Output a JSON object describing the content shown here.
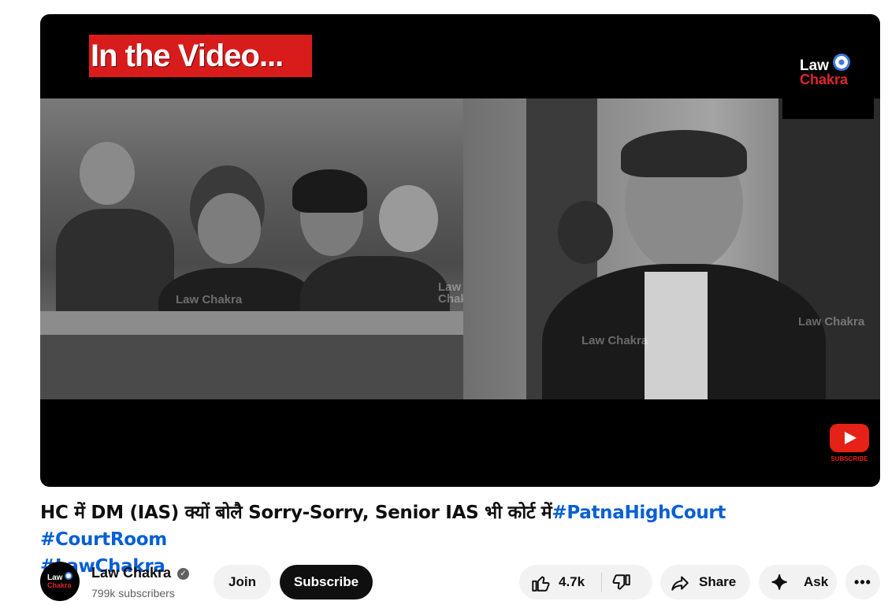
{
  "video": {
    "banner_text": "In the Video...",
    "logo_line1": "Law",
    "logo_line2": "Chakra",
    "watermark": "Law Chakra",
    "subscribe_badge": "SUBSCRIBE"
  },
  "title": {
    "text": "HC में DM (IAS) क्यों बोलै Sorry-Sorry, Senior IAS भी कोर्ट में",
    "hashtags": [
      "#PatnaHighCourt",
      "#CourtRoom",
      "#LawChakra"
    ]
  },
  "channel": {
    "name": "Law Chakra",
    "subscribers": "799k subscribers",
    "avatar_line1": "Law",
    "avatar_line2": "Chakra",
    "verified_icon": "verified-check-icon"
  },
  "actions": {
    "join_label": "Join",
    "subscribe_label": "Subscribe",
    "like_count": "4.7k",
    "share_label": "Share",
    "ask_label": "Ask",
    "more_label": "•••"
  },
  "colors": {
    "link": "#065fd4",
    "subscribe_bg": "#0f0f0f",
    "banner_red": "#d81c1c",
    "pill_bg": "#f2f2f2"
  }
}
